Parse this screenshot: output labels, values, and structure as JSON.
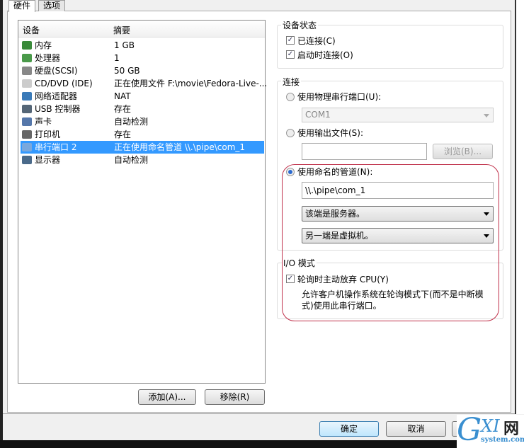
{
  "tabs": [
    "硬件",
    "选项"
  ],
  "device_list": {
    "headers": [
      "设备",
      "摘要"
    ],
    "rows": [
      {
        "name": "内存",
        "summary": "1 GB",
        "icon": "memory-icon",
        "color": "#3a8a3a"
      },
      {
        "name": "处理器",
        "summary": "1",
        "icon": "processor-icon",
        "color": "#4a9a4a"
      },
      {
        "name": "硬盘(SCSI)",
        "summary": "50 GB",
        "icon": "hard-disk-icon",
        "color": "#888888"
      },
      {
        "name": "CD/DVD (IDE)",
        "summary": "正在使用文件 F:\\movie\\Fedora-Live-...",
        "icon": "cd-dvd-icon",
        "color": "#cccccc"
      },
      {
        "name": "网络适配器",
        "summary": "NAT",
        "icon": "network-adapter-icon",
        "color": "#3a7ab8"
      },
      {
        "name": "USB 控制器",
        "summary": "存在",
        "icon": "usb-icon",
        "color": "#556677"
      },
      {
        "name": "声卡",
        "summary": "自动检测",
        "icon": "sound-card-icon",
        "color": "#5577aa"
      },
      {
        "name": "打印机",
        "summary": "存在",
        "icon": "printer-icon",
        "color": "#666666"
      },
      {
        "name": "串行端口 2",
        "summary": "正在使用命名管道 \\\\.\\pipe\\com_1",
        "icon": "serial-port-icon",
        "color": "#7aa8dd",
        "selected": true
      },
      {
        "name": "显示器",
        "summary": "自动检测",
        "icon": "monitor-icon",
        "color": "#4a6a8a"
      }
    ],
    "add_button": "添加(A)...",
    "remove_button": "移除(R)"
  },
  "device_status": {
    "title": "设备状态",
    "connected": "已连接(C)",
    "connect_at_power_on": "启动时连接(O)",
    "connected_checked": true,
    "power_on_checked": true
  },
  "connection": {
    "title": "连接",
    "physical_port": "使用物理串行端口(U):",
    "physical_port_value": "COM1",
    "output_file": "使用输出文件(S):",
    "output_file_value": "",
    "browse": "浏览(B)...",
    "named_pipe": "使用命名的管道(N):",
    "named_pipe_selected": true,
    "pipe_name": "\\\\.\\pipe\\com_1",
    "this_end": "该端是服务器。",
    "other_end": "另一端是虚拟机。"
  },
  "io_mode": {
    "title": "I/O 模式",
    "yield_cpu": "轮询时主动放弃 CPU(Y)",
    "yield_checked": true,
    "description": "允许客户机操作系统在轮询模式下(而不是中断模式)使用此串行端口。"
  },
  "footer": {
    "ok": "确定",
    "cancel": "取消"
  },
  "watermark": "GXI网 system.com",
  "colors": {
    "selection": "#3399ff",
    "highlight_box": "#c0304a"
  }
}
